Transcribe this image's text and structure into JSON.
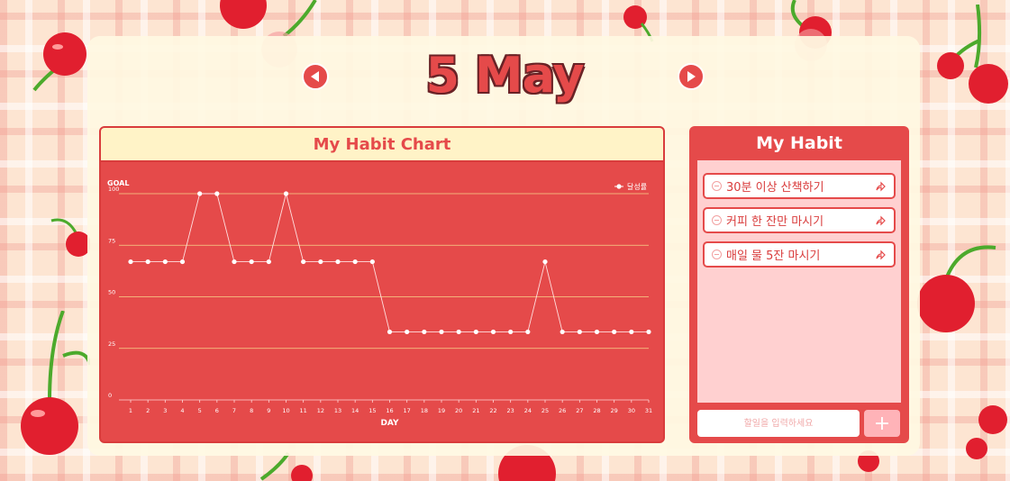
{
  "header": {
    "month_title": "5 May",
    "prev_icon": "triangle-left-icon",
    "next_icon": "triangle-right-icon"
  },
  "colors": {
    "accent": "#e54a4a",
    "panel_header": "#fff3c7",
    "list_background": "#ffd0d0",
    "board": "#fff8e2"
  },
  "chart_panel": {
    "title": "My Habit Chart"
  },
  "chart_data": {
    "type": "line",
    "ylabel": "GOAL",
    "xlabel": "DAY",
    "ylim": [
      0,
      100
    ],
    "yticks": [
      0,
      25,
      50,
      75,
      100
    ],
    "grid": true,
    "legend_position": "top-right",
    "x": [
      1,
      2,
      3,
      4,
      5,
      6,
      7,
      8,
      9,
      10,
      11,
      12,
      13,
      14,
      15,
      16,
      17,
      18,
      19,
      20,
      21,
      22,
      23,
      24,
      25,
      26,
      27,
      28,
      29,
      30,
      31
    ],
    "series": [
      {
        "name": "달성률",
        "values": [
          67,
          67,
          67,
          67,
          100,
          100,
          67,
          67,
          67,
          100,
          67,
          67,
          67,
          67,
          67,
          33,
          33,
          33,
          33,
          33,
          33,
          33,
          33,
          33,
          67,
          33,
          33,
          33,
          33,
          33,
          33
        ]
      }
    ]
  },
  "habit_panel": {
    "title": "My Habit",
    "items": [
      {
        "label": "30분 이상 산책하기",
        "icon": "share-arrow-icon"
      },
      {
        "label": "커피 한 잔만 마시기",
        "icon": "share-arrow-icon"
      },
      {
        "label": "매일 물 5잔 마시기",
        "icon": "share-arrow-icon"
      }
    ],
    "input_placeholder": "할일을 입력하세요",
    "add_button_label": "+"
  }
}
